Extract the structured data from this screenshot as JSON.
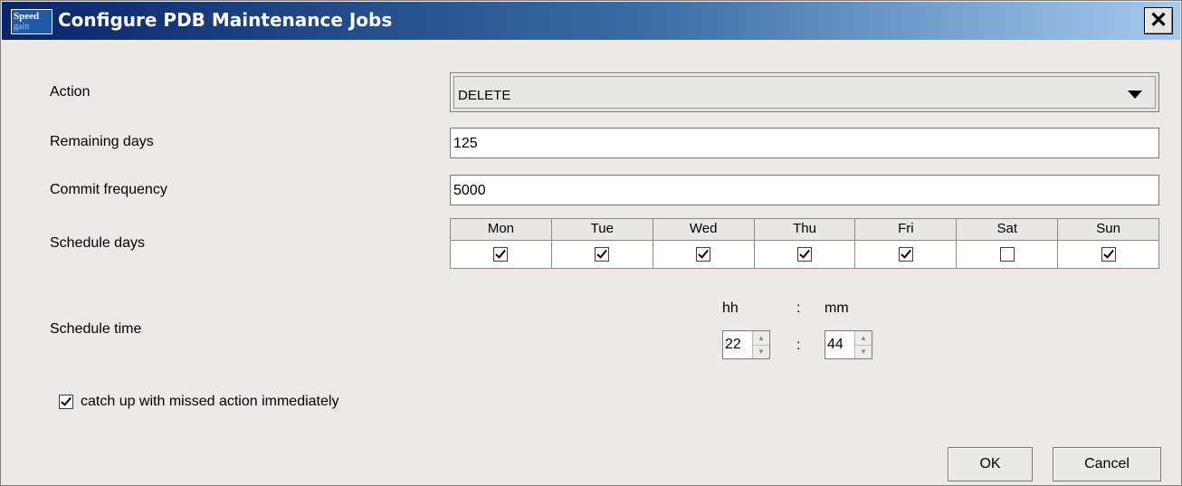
{
  "window": {
    "title": "Configure PDB Maintenance Jobs",
    "app_icon_top": "Speed",
    "app_icon_bottom": "gain",
    "close_glyph": "✕"
  },
  "form": {
    "action_label": "Action",
    "action_value": "DELETE",
    "remaining_days_label": "Remaining days",
    "remaining_days_value": "125",
    "commit_frequency_label": "Commit frequency",
    "commit_frequency_value": "5000",
    "schedule_days_label": "Schedule days",
    "days": [
      {
        "name": "Mon",
        "checked": true
      },
      {
        "name": "Tue",
        "checked": true
      },
      {
        "name": "Wed",
        "checked": true
      },
      {
        "name": "Thu",
        "checked": true
      },
      {
        "name": "Fri",
        "checked": true
      },
      {
        "name": "Sat",
        "checked": false
      },
      {
        "name": "Sun",
        "checked": true
      }
    ],
    "schedule_time_label": "Schedule time",
    "hh_label": "hh",
    "mm_label": "mm",
    "separator": ":",
    "hour_value": "22",
    "minute_value": "44",
    "catchup_label": "catch up with missed action immediately",
    "catchup_checked": true
  },
  "buttons": {
    "ok": "OK",
    "cancel": "Cancel"
  }
}
